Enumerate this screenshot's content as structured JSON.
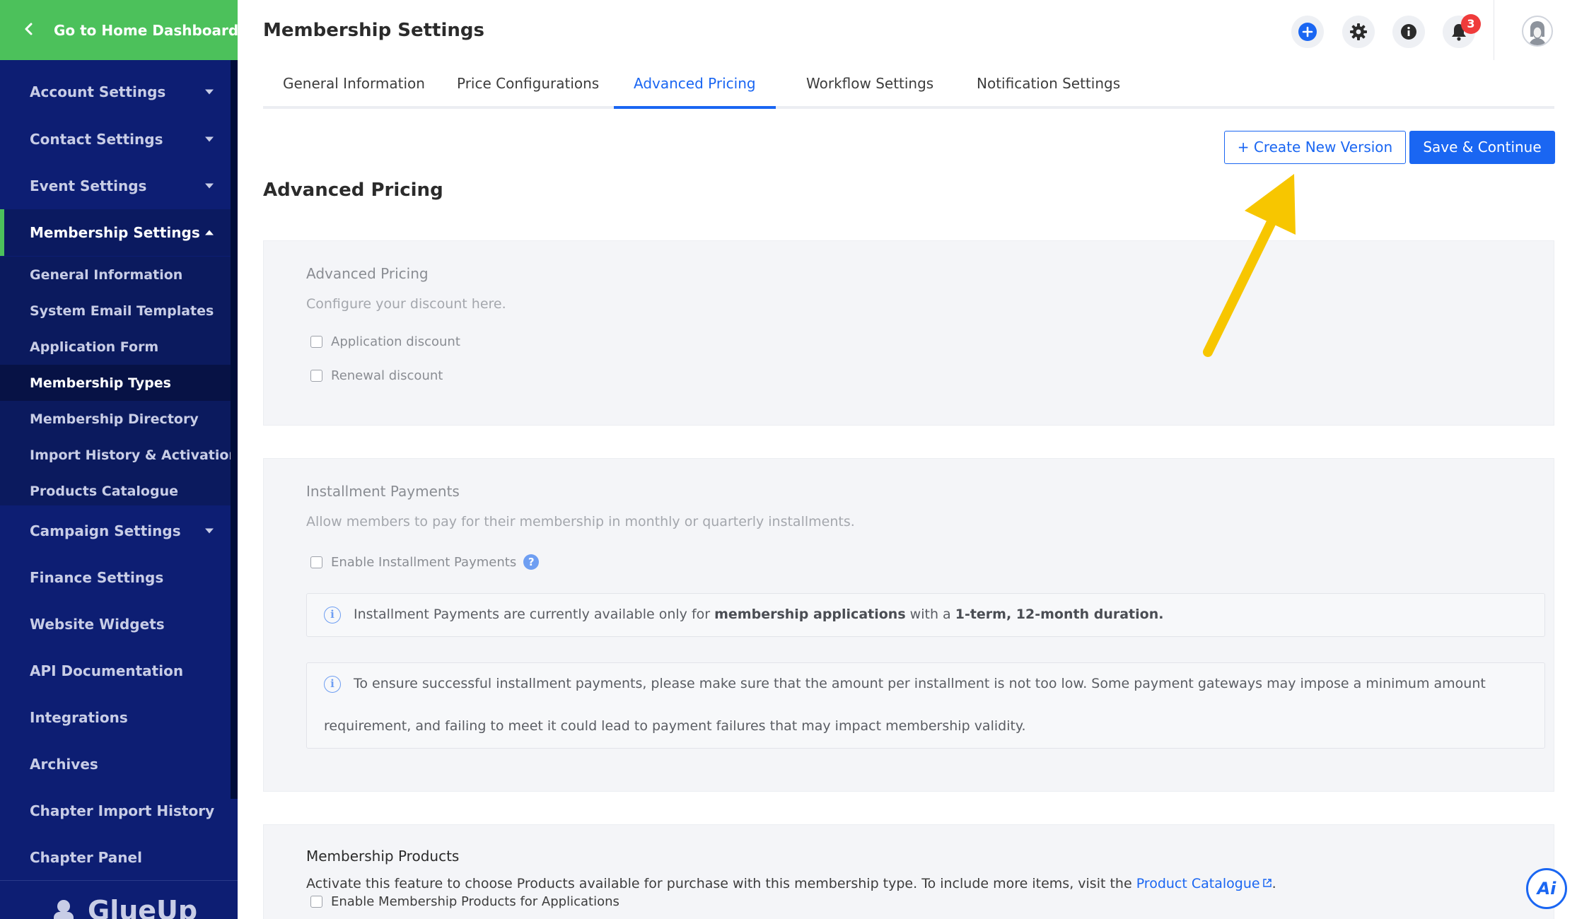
{
  "sidebar": {
    "home_label": "Go to Home Dashboard",
    "items": [
      {
        "label": "Account Settings"
      },
      {
        "label": "Contact Settings"
      },
      {
        "label": "Event Settings"
      },
      {
        "label": "Membership Settings"
      },
      {
        "label": "Campaign Settings"
      },
      {
        "label": "Finance Settings"
      },
      {
        "label": "Website Widgets"
      },
      {
        "label": "API Documentation"
      },
      {
        "label": "Integrations"
      },
      {
        "label": "Archives"
      },
      {
        "label": "Chapter Import History"
      },
      {
        "label": "Chapter Panel"
      }
    ],
    "sub_items": [
      {
        "label": "General Information"
      },
      {
        "label": "System Email Templates"
      },
      {
        "label": "Application Form"
      },
      {
        "label": "Membership Types"
      },
      {
        "label": "Membership Directory"
      },
      {
        "label": "Import History & Activation"
      },
      {
        "label": "Products Catalogue"
      }
    ],
    "brand": "GlueUp"
  },
  "header": {
    "title": "Membership Settings",
    "notification_count": "3",
    "icons": [
      "plus-circle-icon",
      "gear-icon",
      "info-icon",
      "bell-icon",
      "avatar"
    ]
  },
  "tabs": [
    {
      "label": "General Information"
    },
    {
      "label": "Price Configurations"
    },
    {
      "label": "Advanced Pricing"
    },
    {
      "label": "Workflow Settings"
    },
    {
      "label": "Notification Settings"
    }
  ],
  "active_tab": "Advanced Pricing",
  "actions": {
    "create_version": "+ Create New Version",
    "save_continue": "Save & Continue"
  },
  "main": {
    "heading": "Advanced Pricing",
    "advanced_pricing": {
      "title": "Advanced Pricing",
      "desc": "Configure your discount here.",
      "options": [
        "Application discount",
        "Renewal discount"
      ]
    },
    "installments": {
      "title": "Installment Payments",
      "desc": "Allow members to pay for their membership in monthly or quarterly installments.",
      "option": "Enable Installment Payments",
      "help": "?",
      "info1_a": "Installment Payments are currently available only for ",
      "info1_b": "membership applications",
      "info1_c": " with a ",
      "info1_d": "1-term, 12-month duration.",
      "info2_line1": "To ensure successful installment payments, please make sure that the amount per installment is not too low. Some payment gateways may impose a minimum amount",
      "info2_line2": "requirement, and failing to meet it could lead to payment failures that may impact membership validity."
    },
    "products": {
      "title": "Membership Products",
      "desc_a": "Activate this feature to choose Products available for purchase with this membership type. To include more items, visit the ",
      "desc_link": "Product Catalogue",
      "desc_b": ".",
      "option": "Enable Membership Products for Applications"
    }
  },
  "fab_label": "Ai",
  "colors": {
    "sidebar": "#0d1e73",
    "home_green": "#4cc15b",
    "primary": "#1a66f2",
    "arrow": "#f7c600",
    "badge": "#ef3b3b"
  }
}
